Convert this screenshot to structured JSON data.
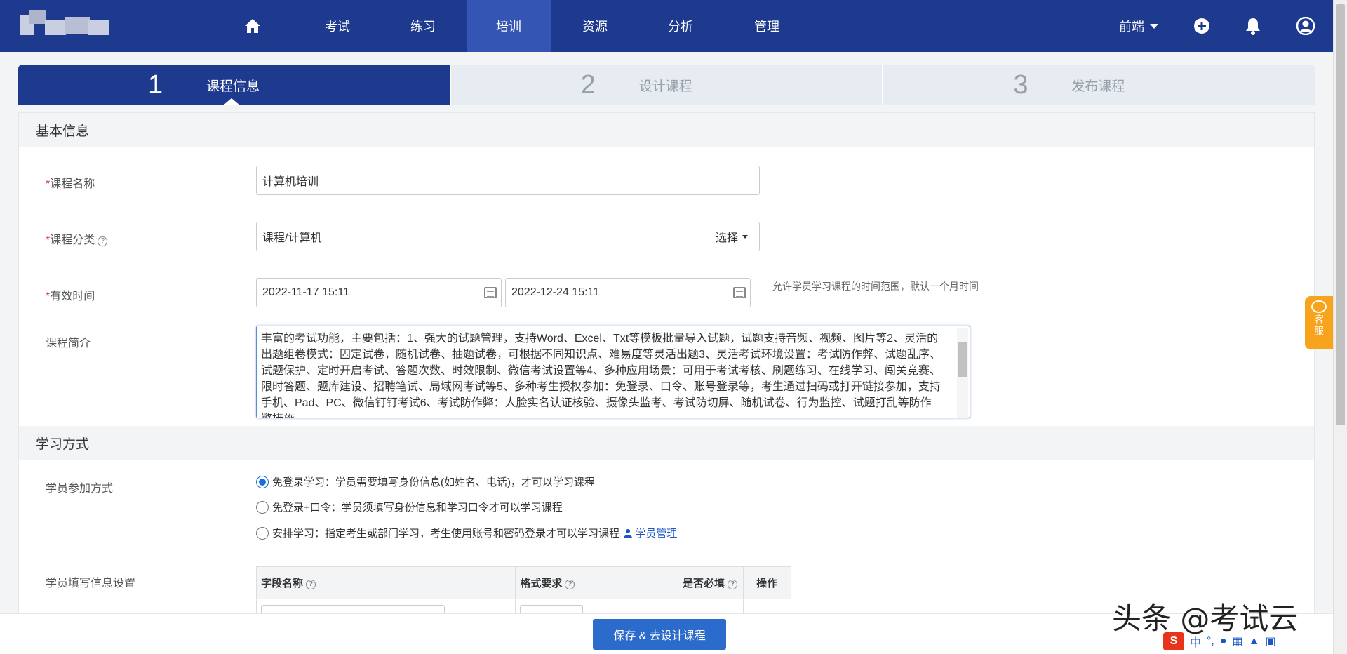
{
  "nav": {
    "items": [
      {
        "label": "考试"
      },
      {
        "label": "练习"
      },
      {
        "label": "培训",
        "active": true
      },
      {
        "label": "资源"
      },
      {
        "label": "分析"
      },
      {
        "label": "管理"
      }
    ],
    "user_menu": "前端",
    "icons": [
      "home-icon",
      "plus-circle-icon",
      "bell-icon",
      "user-icon"
    ]
  },
  "steps": [
    {
      "num": "1",
      "label": "课程信息"
    },
    {
      "num": "2",
      "label": "设计课程"
    },
    {
      "num": "3",
      "label": "发布课程"
    }
  ],
  "basic": {
    "title": "基本信息",
    "course_name_label": "课程名称",
    "course_name_value": "计算机培训",
    "category_label": "课程分类",
    "category_value": "课程/计算机",
    "category_button": "选择",
    "valid_time_label": "有效时间",
    "start_time": "2022-11-17 15:11",
    "end_time": "2022-12-24 15:11",
    "valid_time_hint": "允许学员学习课程的时间范围，默认一个月时间",
    "intro_label": "课程简介",
    "intro_value": "丰富的考试功能，主要包括：1、强大的试题管理，支持Word、Excel、Txt等模板批量导入试题，试题支持音频、视频、图片等2、灵活的出题组卷模式：固定试卷，随机试卷、抽题试卷，可根据不同知识点、难易度等灵活出题3、灵活考试环境设置：考试防作弊、试题乱序、试题保护、定时开启考试、答题次数、时效限制、微信考试设置等4、多种应用场景：可用于考试考核、刷题练习、在线学习、闯关竞赛、限时答题、题库建设、招聘笔试、局域网考试等5、多种考生授权参加：免登录、口令、账号登录等，考生通过扫码或打开链接参加，支持手机、Pad、PC、微信钉钉考试6、考试防作弊：人脸实名认证核验、摄像头监考、考试防切屏、随机试卷、行为监控、试题打乱等防作弊措施"
  },
  "study": {
    "title": "学习方式",
    "join_label": "学员参加方式",
    "options": [
      {
        "text": "免登录学习：学员需要填写身份信息(如姓名、电话)，才可以学习课程",
        "checked": true
      },
      {
        "text": "免登录+口令：学员须填写身份信息和学习口令才可以学习课程",
        "checked": false
      },
      {
        "text": "安排学习：指定考生或部门学习，考生使用账号和密码登录才可以学习课程",
        "checked": false
      }
    ],
    "student_mgmt_link": "学员管理",
    "info_settings_label": "学员填写信息设置",
    "table_headers": [
      "字段名称",
      "格式要求",
      "是否必填",
      "操作"
    ]
  },
  "footer": {
    "save_button": "保存 & 去设计课程"
  },
  "service": {
    "label": "客服"
  },
  "watermark": "头条 @考试云",
  "ime": {
    "label": "中"
  }
}
